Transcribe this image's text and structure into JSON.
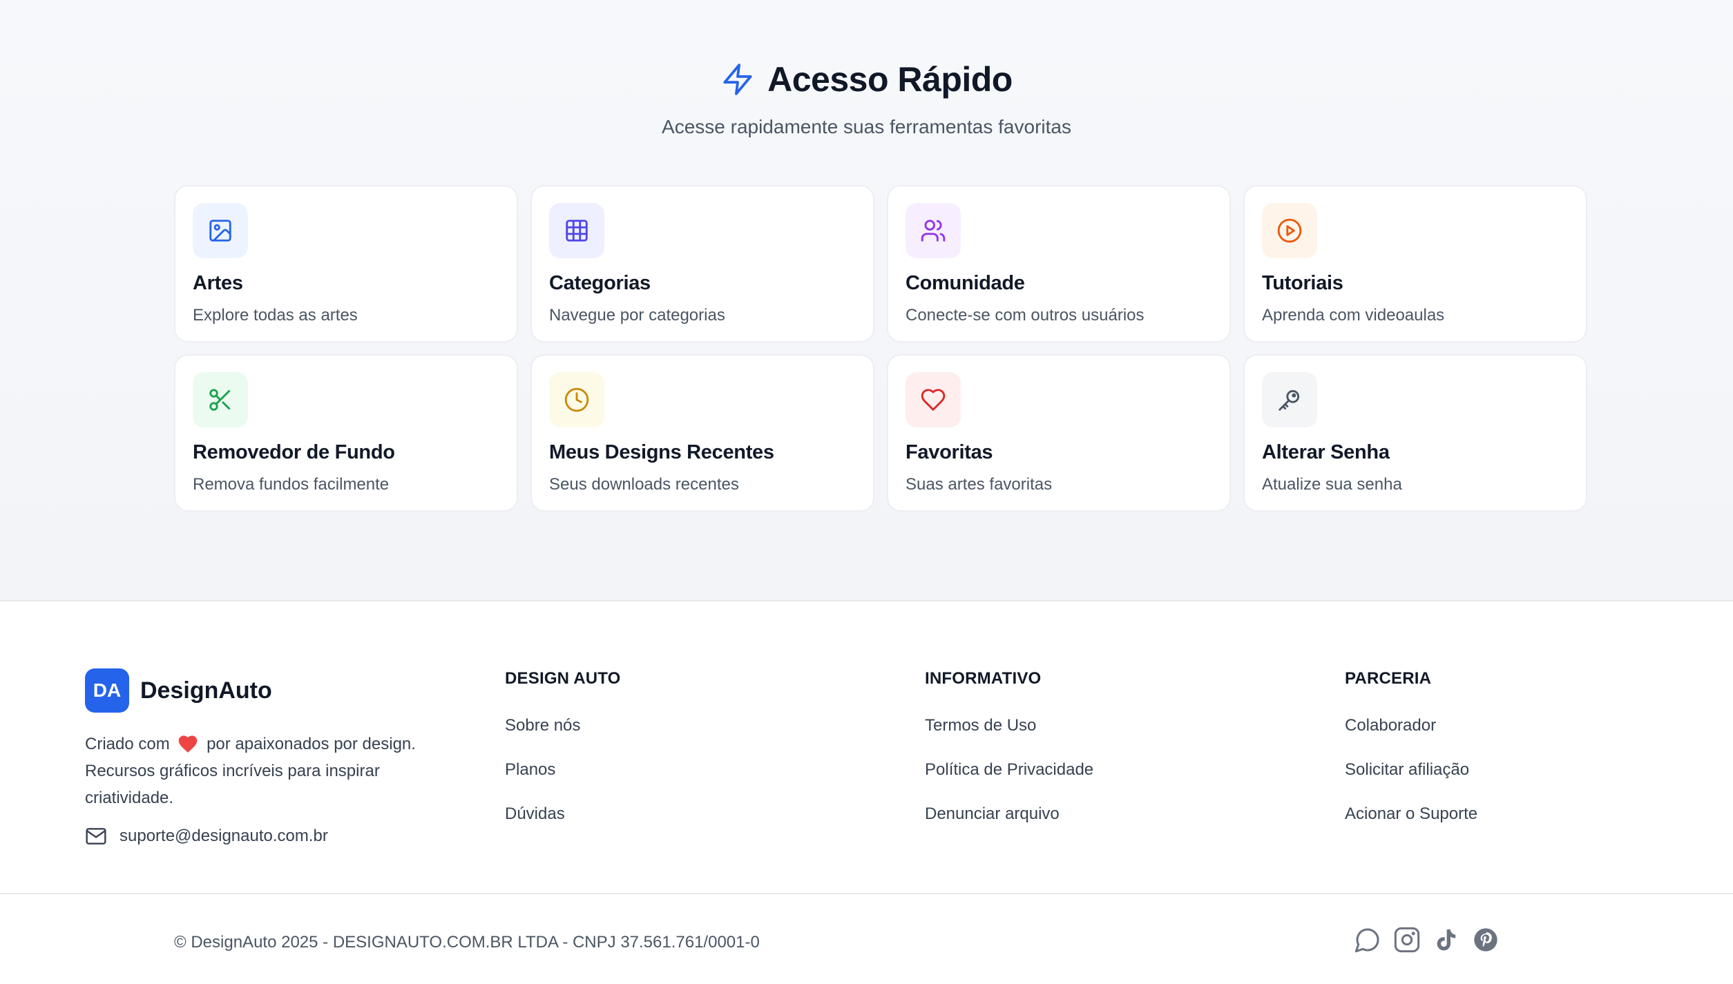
{
  "quick_access": {
    "title": "Acesso Rápido",
    "subtitle": "Acesse rapidamente suas ferramentas favoritas",
    "cards": [
      {
        "title": "Artes",
        "description": "Explore todas as artes",
        "icon": "image-icon",
        "color": "#2563eb",
        "bg": "#eef4ff"
      },
      {
        "title": "Categorias",
        "description": "Navegue por categorias",
        "icon": "grid-icon",
        "color": "#4f46e5",
        "bg": "#eef0ff"
      },
      {
        "title": "Comunidade",
        "description": "Conecte-se com outros usuários",
        "icon": "users-icon",
        "color": "#9333ea",
        "bg": "#f7efff"
      },
      {
        "title": "Tutoriais",
        "description": "Aprenda com videoaulas",
        "icon": "play-circle-icon",
        "color": "#ea580c",
        "bg": "#fff4ea"
      },
      {
        "title": "Removedor de Fundo",
        "description": "Remova fundos facilmente",
        "icon": "scissors-icon",
        "color": "#16a34a",
        "bg": "#ebfbf0"
      },
      {
        "title": "Meus Designs Recentes",
        "description": "Seus downloads recentes",
        "icon": "clock-icon",
        "color": "#ca8a04",
        "bg": "#fefae8"
      },
      {
        "title": "Favoritas",
        "description": "Suas artes favoritas",
        "icon": "heart-icon",
        "color": "#dc2626",
        "bg": "#feeeee"
      },
      {
        "title": "Alterar Senha",
        "description": "Atualize sua senha",
        "icon": "key-icon",
        "color": "#4b5563",
        "bg": "#f4f5f7"
      }
    ]
  },
  "footer": {
    "brand_logo": "DA",
    "brand_name": "DesignAuto",
    "about_part1": "Criado com",
    "about_part2": "por apaixonados por design. Recursos gráficos incríveis para inspirar criatividade.",
    "email": "suporte@designauto.com.br",
    "columns": [
      {
        "title": "DESIGN AUTO",
        "links": [
          "Sobre nós",
          "Planos",
          "Dúvidas"
        ]
      },
      {
        "title": "INFORMATIVO",
        "links": [
          "Termos de Uso",
          "Política de Privacidade",
          "Denunciar arquivo"
        ]
      },
      {
        "title": "PARCERIA",
        "links": [
          "Colaborador",
          "Solicitar afiliação",
          "Acionar o Suporte"
        ]
      }
    ],
    "copyright": "© DesignAuto 2025 - DESIGNAUTO.COM.BR LTDA - CNPJ 37.561.761/0001-0",
    "social": [
      "whatsapp-icon",
      "instagram-icon",
      "tiktok-icon",
      "pinterest-icon"
    ],
    "accent_color": "#2563eb",
    "heart_color": "#ef4444"
  }
}
